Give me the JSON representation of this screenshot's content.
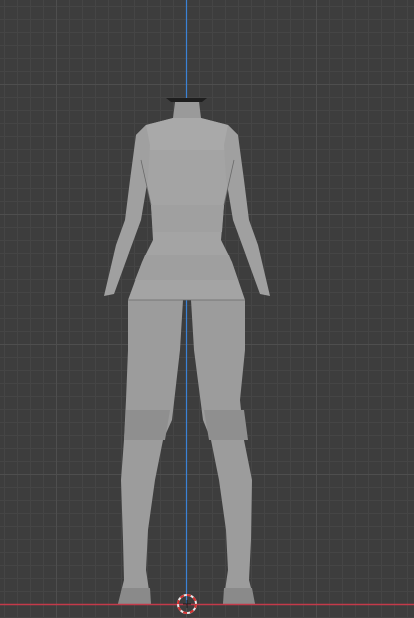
{
  "viewport": {
    "background_color": "#3d3d3d",
    "grid_minor_color": "#454545",
    "grid_major_color": "#4e4e4e",
    "z_axis_color": "#3b82d6",
    "x_axis_color": "#c43a4a",
    "mesh_color": "#a2a2a2",
    "mesh_shade_color": "#8e8e8e",
    "mesh_edge_color": "#6a6a6a",
    "cursor_ring_color": "#e8e8e8",
    "cursor_dash_color": "#d23030"
  },
  "scene": {
    "object": "female-base-mesh",
    "shading": "solid",
    "view": "front-orthographic"
  }
}
